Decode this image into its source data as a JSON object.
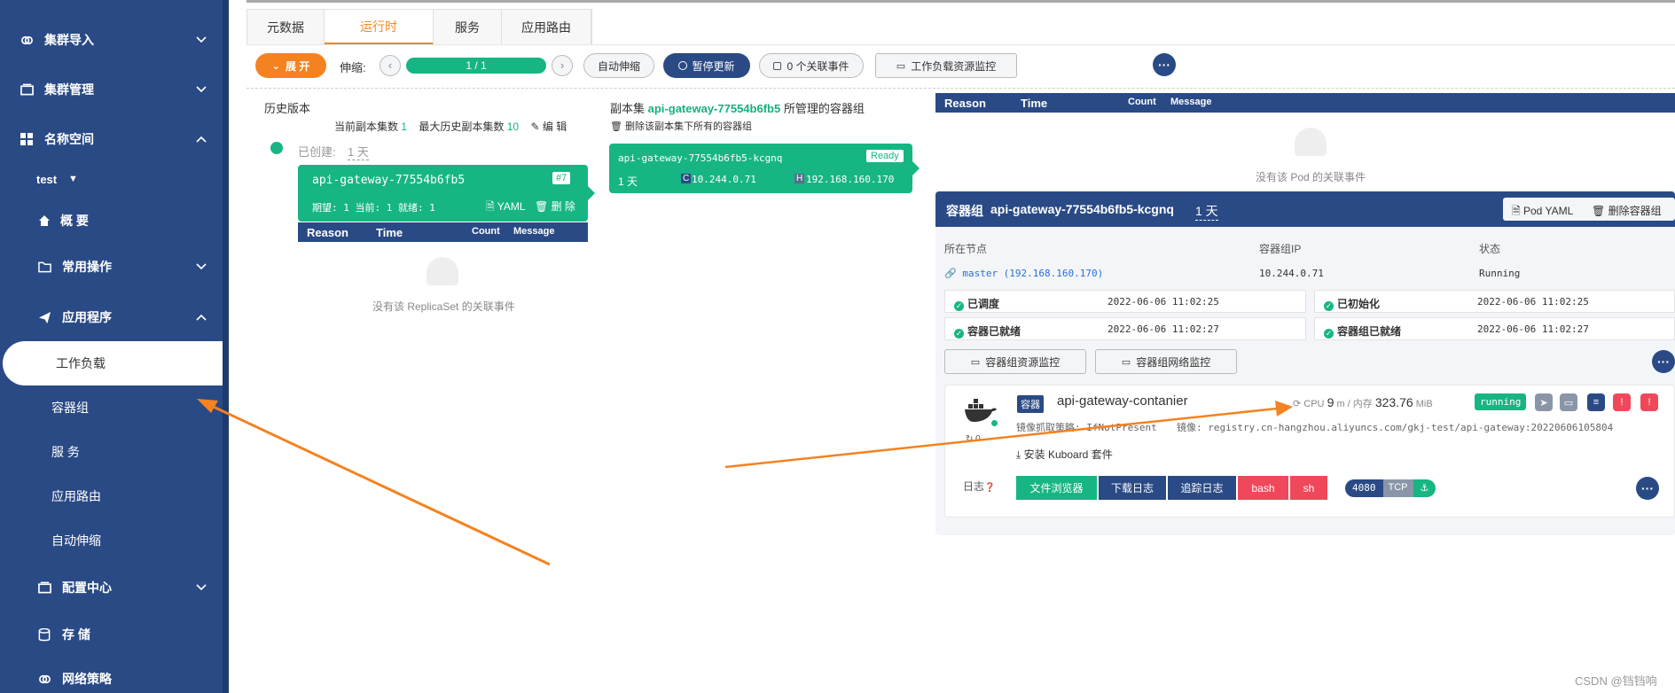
{
  "sidebar": {
    "items": [
      {
        "label": "集群导入",
        "icon": "link-icon",
        "chevron": "⌄"
      },
      {
        "label": "集群管理",
        "icon": "server-icon",
        "chevron": "⌄"
      },
      {
        "label": "名称空间",
        "icon": "grid-icon",
        "chevron": "⌃"
      }
    ],
    "namespace": "test",
    "namespace_arrow": "▼",
    "sub": [
      {
        "label": "概 要",
        "icon": "home-icon"
      },
      {
        "label": "常用操作",
        "icon": "folder-icon",
        "chevron": "⌄"
      },
      {
        "label": "应用程序",
        "icon": "send-icon",
        "chevron": "⌃"
      }
    ],
    "app_items": [
      "工作负载",
      "容器组",
      "服 务",
      "应用路由",
      "自动伸缩"
    ],
    "bottom": [
      {
        "label": "配置中心",
        "icon": "config-icon",
        "chevron": "⌄"
      },
      {
        "label": "存 储",
        "icon": "database-icon"
      },
      {
        "label": "网络策略",
        "icon": "network-icon"
      }
    ]
  },
  "tabs": [
    "元数据",
    "运行时",
    "服务",
    "应用路由"
  ],
  "toolbar": {
    "expand": "展 开",
    "scale_label": "伸缩:",
    "scale_value": "1 / 1",
    "autoscale": "自动伸缩",
    "pause": "暂停更新",
    "events": "0 个关联事件",
    "monitor": "工作负载资源监控"
  },
  "history": {
    "title": "历史版本",
    "current_label": "当前副本集数",
    "current_value": "1",
    "max_label": "最大历史副本集数",
    "max_value": "10",
    "edit": "编 辑",
    "created_label": "已创建:",
    "created_value": "1 天",
    "rs_name": "api-gateway-77554b6fb5",
    "rs_badge": "#7",
    "rs_status": "期望: 1 当前: 1 就绪: 1",
    "yaml": "YAML",
    "delete": "删 除",
    "empty_events": "没有该 ReplicaSet 的关联事件"
  },
  "events_cols": [
    "Reason",
    "Time",
    "Count",
    "Message"
  ],
  "replicaset": {
    "prefix": "副本集",
    "name": "api-gateway-77554b6fb5",
    "suffix": "所管理的容器组",
    "delete_all": "删除该副本集下所有的容器组",
    "pod_name": "api-gateway-77554b6fb5-kcgnq",
    "pod_status": "Ready",
    "pod_age": "1 天",
    "c_tag": "C",
    "pod_ip": "10.244.0.71",
    "h_tag": "H",
    "host_ip": "192.168.160.170"
  },
  "pod_events_empty": "没有该 Pod 的关联事件",
  "pod": {
    "title_prefix": "容器组",
    "name": "api-gateway-77554b6fb5-kcgnq",
    "age": "1 天",
    "yaml_btn": "Pod YAML",
    "delete_btn": "删除容器组",
    "node_label": "所在节点",
    "node_value": "master (192.168.160.170)",
    "ip_label": "容器组IP",
    "ip_value": "10.244.0.71",
    "status_label": "状态",
    "status_value": "Running",
    "conditions": [
      {
        "label": "已调度",
        "time": "2022-06-06 11:02:25"
      },
      {
        "label": "已初始化",
        "time": "2022-06-06 11:02:25"
      },
      {
        "label": "容器已就绪",
        "time": "2022-06-06 11:02:27"
      },
      {
        "label": "容器组已就绪",
        "time": "2022-06-06 11:02:27"
      }
    ],
    "res_monitor": "容器组资源监控",
    "net_monitor": "容器组网络监控"
  },
  "container": {
    "tag": "容器",
    "name": "api-gateway-contanier",
    "cpu_label": "CPU",
    "cpu_value": "9",
    "cpu_unit": "m / 内存",
    "mem_value": "323.76",
    "mem_unit": "MiB",
    "state": "running",
    "pull_policy": "镜像抓取策略: IfNotPresent",
    "image": "镜像: registry.cn-hangzhou.aliyuncs.com/gkj-test/api-gateway:20220606105804",
    "restarts": "0",
    "install": "安装 Kuboard 套件",
    "log_label": "日志",
    "btn_files": "文件浏览器",
    "btn_download": "下载日志",
    "btn_follow": "追踪日志",
    "btn_bash": "bash",
    "btn_sh": "sh",
    "port": "4080",
    "proto": "TCP"
  },
  "watermark": "CSDN @铛铛响",
  "colors": {
    "primary": "#2a4a85",
    "green": "#17b584",
    "orange": "#f58220",
    "red": "#f0485b"
  }
}
